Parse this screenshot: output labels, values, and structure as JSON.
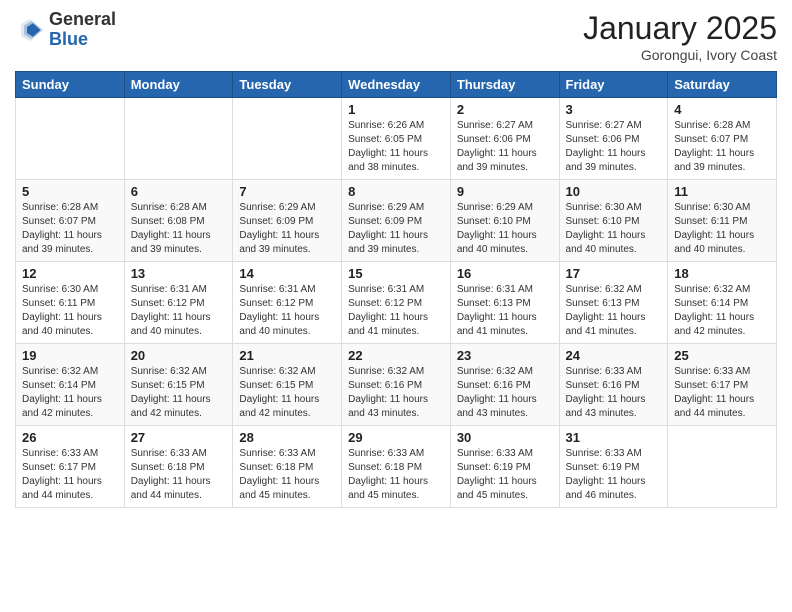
{
  "logo": {
    "general": "General",
    "blue": "Blue"
  },
  "title": "January 2025",
  "location": "Gorongui, Ivory Coast",
  "days_of_week": [
    "Sunday",
    "Monday",
    "Tuesday",
    "Wednesday",
    "Thursday",
    "Friday",
    "Saturday"
  ],
  "weeks": [
    [
      {
        "day": "",
        "info": ""
      },
      {
        "day": "",
        "info": ""
      },
      {
        "day": "",
        "info": ""
      },
      {
        "day": "1",
        "info": "Sunrise: 6:26 AM\nSunset: 6:05 PM\nDaylight: 11 hours and 38 minutes."
      },
      {
        "day": "2",
        "info": "Sunrise: 6:27 AM\nSunset: 6:06 PM\nDaylight: 11 hours and 39 minutes."
      },
      {
        "day": "3",
        "info": "Sunrise: 6:27 AM\nSunset: 6:06 PM\nDaylight: 11 hours and 39 minutes."
      },
      {
        "day": "4",
        "info": "Sunrise: 6:28 AM\nSunset: 6:07 PM\nDaylight: 11 hours and 39 minutes."
      }
    ],
    [
      {
        "day": "5",
        "info": "Sunrise: 6:28 AM\nSunset: 6:07 PM\nDaylight: 11 hours and 39 minutes."
      },
      {
        "day": "6",
        "info": "Sunrise: 6:28 AM\nSunset: 6:08 PM\nDaylight: 11 hours and 39 minutes."
      },
      {
        "day": "7",
        "info": "Sunrise: 6:29 AM\nSunset: 6:09 PM\nDaylight: 11 hours and 39 minutes."
      },
      {
        "day": "8",
        "info": "Sunrise: 6:29 AM\nSunset: 6:09 PM\nDaylight: 11 hours and 39 minutes."
      },
      {
        "day": "9",
        "info": "Sunrise: 6:29 AM\nSunset: 6:10 PM\nDaylight: 11 hours and 40 minutes."
      },
      {
        "day": "10",
        "info": "Sunrise: 6:30 AM\nSunset: 6:10 PM\nDaylight: 11 hours and 40 minutes."
      },
      {
        "day": "11",
        "info": "Sunrise: 6:30 AM\nSunset: 6:11 PM\nDaylight: 11 hours and 40 minutes."
      }
    ],
    [
      {
        "day": "12",
        "info": "Sunrise: 6:30 AM\nSunset: 6:11 PM\nDaylight: 11 hours and 40 minutes."
      },
      {
        "day": "13",
        "info": "Sunrise: 6:31 AM\nSunset: 6:12 PM\nDaylight: 11 hours and 40 minutes."
      },
      {
        "day": "14",
        "info": "Sunrise: 6:31 AM\nSunset: 6:12 PM\nDaylight: 11 hours and 40 minutes."
      },
      {
        "day": "15",
        "info": "Sunrise: 6:31 AM\nSunset: 6:12 PM\nDaylight: 11 hours and 41 minutes."
      },
      {
        "day": "16",
        "info": "Sunrise: 6:31 AM\nSunset: 6:13 PM\nDaylight: 11 hours and 41 minutes."
      },
      {
        "day": "17",
        "info": "Sunrise: 6:32 AM\nSunset: 6:13 PM\nDaylight: 11 hours and 41 minutes."
      },
      {
        "day": "18",
        "info": "Sunrise: 6:32 AM\nSunset: 6:14 PM\nDaylight: 11 hours and 42 minutes."
      }
    ],
    [
      {
        "day": "19",
        "info": "Sunrise: 6:32 AM\nSunset: 6:14 PM\nDaylight: 11 hours and 42 minutes."
      },
      {
        "day": "20",
        "info": "Sunrise: 6:32 AM\nSunset: 6:15 PM\nDaylight: 11 hours and 42 minutes."
      },
      {
        "day": "21",
        "info": "Sunrise: 6:32 AM\nSunset: 6:15 PM\nDaylight: 11 hours and 42 minutes."
      },
      {
        "day": "22",
        "info": "Sunrise: 6:32 AM\nSunset: 6:16 PM\nDaylight: 11 hours and 43 minutes."
      },
      {
        "day": "23",
        "info": "Sunrise: 6:32 AM\nSunset: 6:16 PM\nDaylight: 11 hours and 43 minutes."
      },
      {
        "day": "24",
        "info": "Sunrise: 6:33 AM\nSunset: 6:16 PM\nDaylight: 11 hours and 43 minutes."
      },
      {
        "day": "25",
        "info": "Sunrise: 6:33 AM\nSunset: 6:17 PM\nDaylight: 11 hours and 44 minutes."
      }
    ],
    [
      {
        "day": "26",
        "info": "Sunrise: 6:33 AM\nSunset: 6:17 PM\nDaylight: 11 hours and 44 minutes."
      },
      {
        "day": "27",
        "info": "Sunrise: 6:33 AM\nSunset: 6:18 PM\nDaylight: 11 hours and 44 minutes."
      },
      {
        "day": "28",
        "info": "Sunrise: 6:33 AM\nSunset: 6:18 PM\nDaylight: 11 hours and 45 minutes."
      },
      {
        "day": "29",
        "info": "Sunrise: 6:33 AM\nSunset: 6:18 PM\nDaylight: 11 hours and 45 minutes."
      },
      {
        "day": "30",
        "info": "Sunrise: 6:33 AM\nSunset: 6:19 PM\nDaylight: 11 hours and 45 minutes."
      },
      {
        "day": "31",
        "info": "Sunrise: 6:33 AM\nSunset: 6:19 PM\nDaylight: 11 hours and 46 minutes."
      },
      {
        "day": "",
        "info": ""
      }
    ]
  ]
}
